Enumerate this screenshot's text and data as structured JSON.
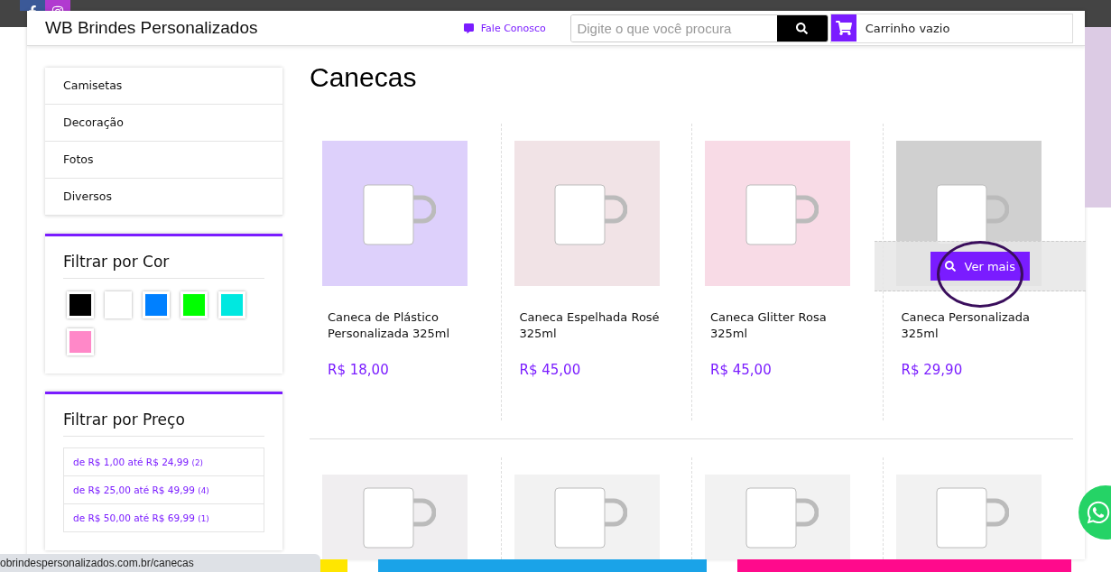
{
  "header": {
    "title": "WB Brindes Personalizados",
    "contact_link": "Fale Conosco",
    "search": {
      "placeholder": "Digite o que você procura"
    },
    "cart": "Carrinho vazio"
  },
  "sidebar": {
    "categories": [
      "Camisetas",
      "Decoração",
      "Fotos",
      "Diversos"
    ],
    "color_filter": {
      "title": "Filtrar por Cor",
      "swatches": [
        {
          "color": "#000000"
        },
        {
          "color": "#ffffff"
        },
        {
          "color": "#0080ff"
        },
        {
          "color": "#00ff00"
        },
        {
          "color": "#00e8e0"
        },
        {
          "color": "#ff88c8"
        }
      ]
    },
    "price_filter": {
      "title": "Filtrar por Preço",
      "ranges": [
        {
          "label": "de R$ 1,00 até R$ 24,99",
          "count": "(2)"
        },
        {
          "label": "de R$ 25,00 até R$ 49,99",
          "count": "(4)"
        },
        {
          "label": "de R$ 50,00 até R$ 69,99",
          "count": "(1)"
        }
      ]
    }
  },
  "category_title": "Canecas",
  "products": [
    {
      "name": "Caneca de Plástico Personalizada 325ml",
      "price": "R$ 18,00",
      "hovered": false
    },
    {
      "name": "Caneca Espelhada Rosé 325ml",
      "price": "R$ 45,00",
      "hovered": false
    },
    {
      "name": "Caneca Glitter Rosa 325ml",
      "price": "R$ 45,00",
      "hovered": false
    },
    {
      "name": "Caneca Personalizada 325ml",
      "price": "R$ 29,90",
      "hovered": true,
      "overlay_button": "Ver mais"
    },
    {
      "hovered": false
    },
    {
      "hovered": false
    },
    {
      "hovered": false
    },
    {
      "hovered": false
    }
  ],
  "status_url": "obrindespersonalizados.com.br/canecas"
}
